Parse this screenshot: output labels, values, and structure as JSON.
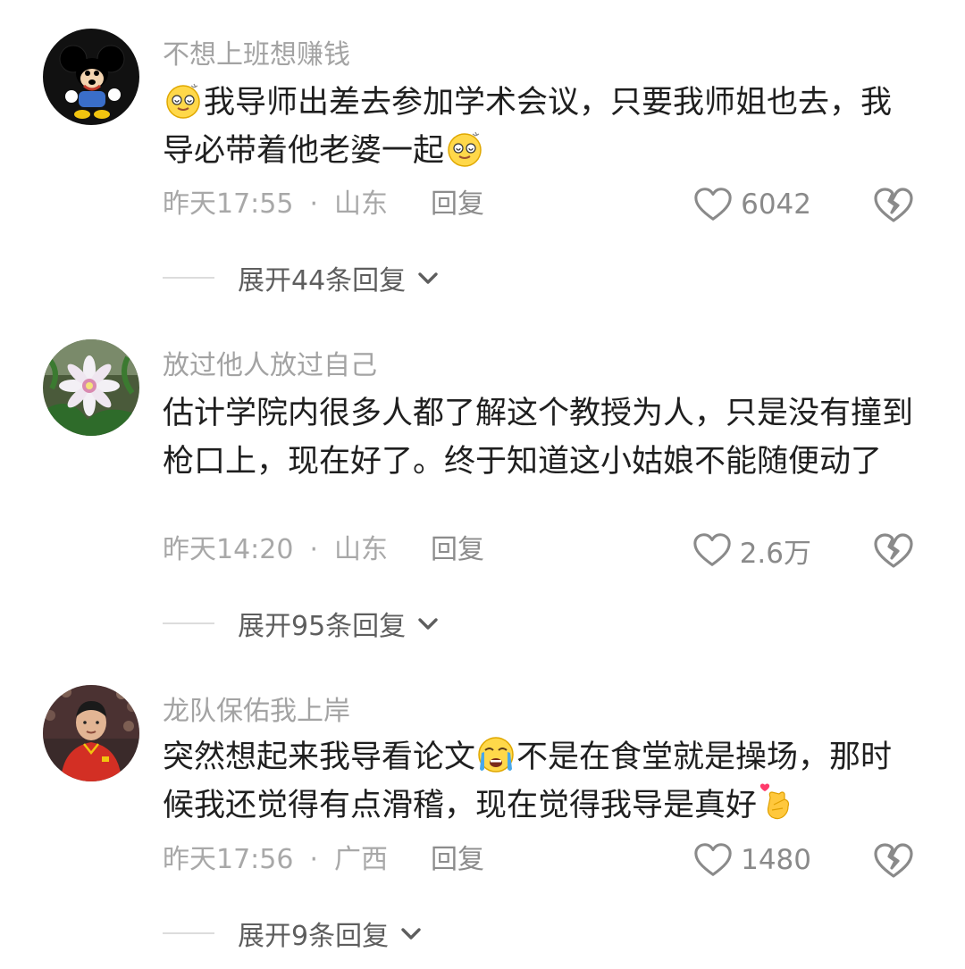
{
  "comments": [
    {
      "username": "不想上班想赚钱",
      "text_parts": [
        "",
        "我导师出差去参加学术会议，只要我师姐也去，我导必带着他老婆一起",
        ""
      ],
      "emoji_1": "dizzy-face-emoji",
      "emoji_2": "dizzy-face-emoji",
      "time": "昨天17:55",
      "separator": "·",
      "location": "山东",
      "reply_label": "回复",
      "likes": "6042",
      "expand_label": "展开44条回复",
      "avatar": "mickey-mouse-avatar"
    },
    {
      "username": "放过他人放过自己",
      "text": "估计学院内很多人都了解这个教授为人，只是没有撞到枪口上，现在好了。终于知道这小姑娘不能随便动了",
      "time": "昨天14:20",
      "separator": "·",
      "location": "山东",
      "reply_label": "回复",
      "likes": "2.6万",
      "expand_label": "展开95条回复",
      "avatar": "flower-avatar"
    },
    {
      "username": "龙队保佑我上岸",
      "text_parts": [
        "突然想起来我导看论文",
        "不是在食堂就是操场，那时候我还觉得有点滑稽，现在觉得我导是真好",
        ""
      ],
      "emoji_1": "crying-face-emoji",
      "emoji_2": "finger-heart-emoji",
      "time": "昨天17:56",
      "separator": "·",
      "location": "广西",
      "reply_label": "回复",
      "likes": "1480",
      "expand_label": "展开9条回复",
      "avatar": "athlete-avatar"
    }
  ],
  "icons": {
    "like": "heart-outline-icon",
    "dislike": "broken-heart-icon",
    "expand": "chevron-down-icon"
  },
  "colors": {
    "username": "#a3a3a3",
    "body": "#1f1f1f",
    "meta": "#a8a8a8",
    "expand": "#5e5e5e"
  }
}
